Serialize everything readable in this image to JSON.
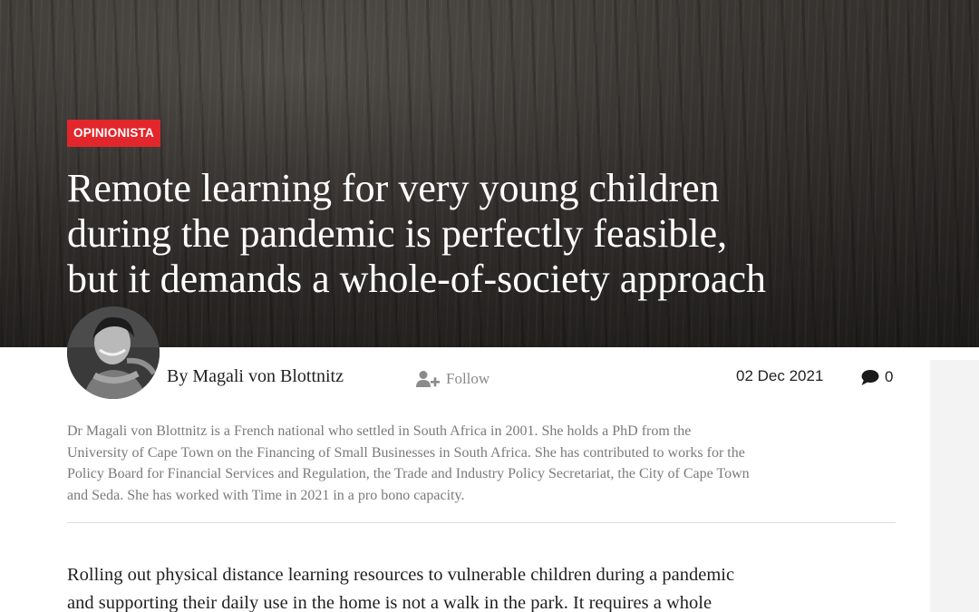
{
  "article": {
    "category": "OPINIONISTA",
    "headline_lines": [
      "Remote learning for very young children",
      "during the pandemic is perfectly feasible,",
      "but it demands a whole-of-society approach"
    ],
    "author": {
      "byline": "By Magali von Blottnitz",
      "follow_label": "Follow",
      "bio_lines": [
        "Dr Magali von Blottnitz is a French national who settled in South Africa in 2001. She holds a PhD from the",
        "University of Cape Town on the Financing of Small Businesses in South Africa. She has contributed to works for the",
        "Policy Board for Financial Services and Regulation, the Trade and Industry Policy Secretariat, the City of Cape Town",
        "and Seda. She has worked with Time in 2021 in a pro bono capacity."
      ]
    },
    "date": "02 Dec 2021",
    "comment_count": "0",
    "body_lines": [
      "Rolling out physical distance learning resources to vulnerable children during a pandemic",
      "and supporting their daily use in the home is not a walk in the park. It requires a whole"
    ]
  },
  "icons": {
    "follow": "user-plus-icon",
    "comments": "speech-bubble-icon"
  },
  "colors": {
    "category_badge": "#e3262b",
    "headline": "#ffffff",
    "bio_text": "#7a7a7a",
    "follow_text": "#8a8a8a"
  }
}
